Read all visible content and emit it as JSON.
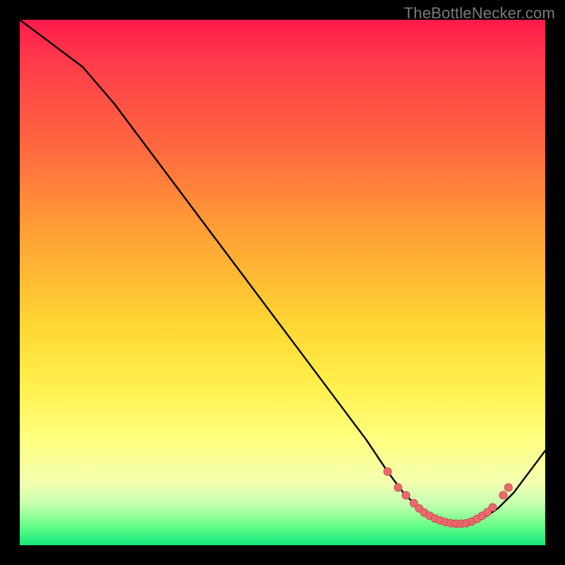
{
  "watermark": "TheBottleNecker.com",
  "colors": {
    "page_bg": "#000000",
    "curve": "#000000",
    "dot_fill": "#e96a6d",
    "dot_stroke": "#cf4e51"
  },
  "chart_data": {
    "type": "line",
    "title": "",
    "xlabel": "",
    "ylabel": "",
    "xlim": [
      0,
      100
    ],
    "ylim": [
      0,
      100
    ],
    "grid": false,
    "legend": false,
    "series": [
      {
        "name": "curve",
        "x": [
          0,
          4,
          8,
          12,
          18,
          24,
          30,
          36,
          42,
          48,
          54,
          60,
          66,
          70,
          73,
          76,
          79,
          82,
          85,
          88,
          91,
          94,
          97,
          100
        ],
        "y": [
          100,
          97,
          94,
          91,
          84,
          76,
          68,
          60,
          52,
          44,
          36,
          28,
          20,
          14,
          10,
          7,
          5,
          4,
          4,
          5,
          7,
          10,
          14,
          18
        ]
      }
    ],
    "dots": {
      "x": [
        70,
        72,
        73.5,
        75,
        76,
        77,
        78,
        79,
        80,
        81,
        82,
        83,
        84,
        85,
        86,
        87,
        88,
        89,
        90,
        92,
        93
      ],
      "y": [
        14,
        11,
        9.5,
        8,
        7,
        6.2,
        5.6,
        5.1,
        4.7,
        4.4,
        4.2,
        4.1,
        4.1,
        4.2,
        4.5,
        5,
        5.6,
        6.3,
        7.2,
        9.5,
        11
      ]
    }
  }
}
